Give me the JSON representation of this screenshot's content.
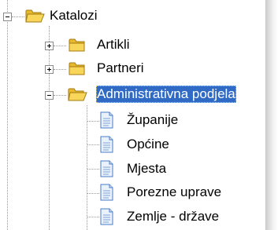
{
  "tree": {
    "root": {
      "label": "Katalozi",
      "expanded": true,
      "icon": "folder-open-icon"
    },
    "children": [
      {
        "label": "Artikli",
        "expanded": false,
        "icon": "folder-icon"
      },
      {
        "label": "Partneri",
        "expanded": false,
        "icon": "folder-icon"
      },
      {
        "label": "Administrativna podjela",
        "expanded": true,
        "selected": true,
        "icon": "folder-open-icon",
        "children": [
          {
            "label": "Županije",
            "icon": "document-icon"
          },
          {
            "label": "Općine",
            "icon": "document-icon"
          },
          {
            "label": "Mjesta",
            "icon": "document-icon"
          },
          {
            "label": "Porezne uprave",
            "icon": "document-icon"
          },
          {
            "label": "Zemlje - države",
            "icon": "document-icon"
          }
        ]
      }
    ]
  },
  "colors": {
    "selection": "#316ac5",
    "folder": "#f2c83e",
    "document": "#4a7cc7"
  }
}
